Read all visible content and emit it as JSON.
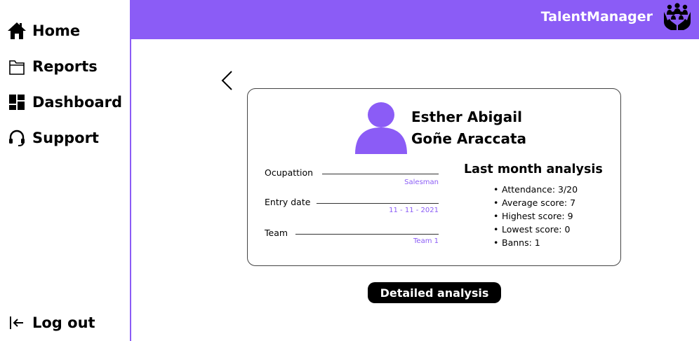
{
  "header": {
    "brand": "TalentManager",
    "logo_icon": "people-in-hands-icon",
    "color": "#8b5cf6"
  },
  "sidebar": {
    "items": [
      {
        "label": "Home",
        "icon": "home-icon"
      },
      {
        "label": "Reports",
        "icon": "folder-icon"
      },
      {
        "label": "Dashboard",
        "icon": "dashboard-icon"
      },
      {
        "label": "Support",
        "icon": "headset-icon"
      }
    ],
    "logout": {
      "label": "Log out",
      "icon": "logout-icon"
    }
  },
  "profile": {
    "first_line": "Esther Abigail",
    "second_line": "Goñe Araccata",
    "fields": [
      {
        "label": "Ocupattion",
        "value": "Salesman"
      },
      {
        "label": "Entry date",
        "value": "11 - 11 - 2021"
      },
      {
        "label": "Team",
        "value": "Team 1"
      }
    ]
  },
  "analysis": {
    "title": "Last month analysis",
    "items": [
      "Attendance: 3/20",
      "Average score: 7",
      "Highest score: 9",
      "Lowest score: 0",
      "Banns: 1"
    ]
  },
  "actions": {
    "detail_label": "Detailed analysis"
  }
}
